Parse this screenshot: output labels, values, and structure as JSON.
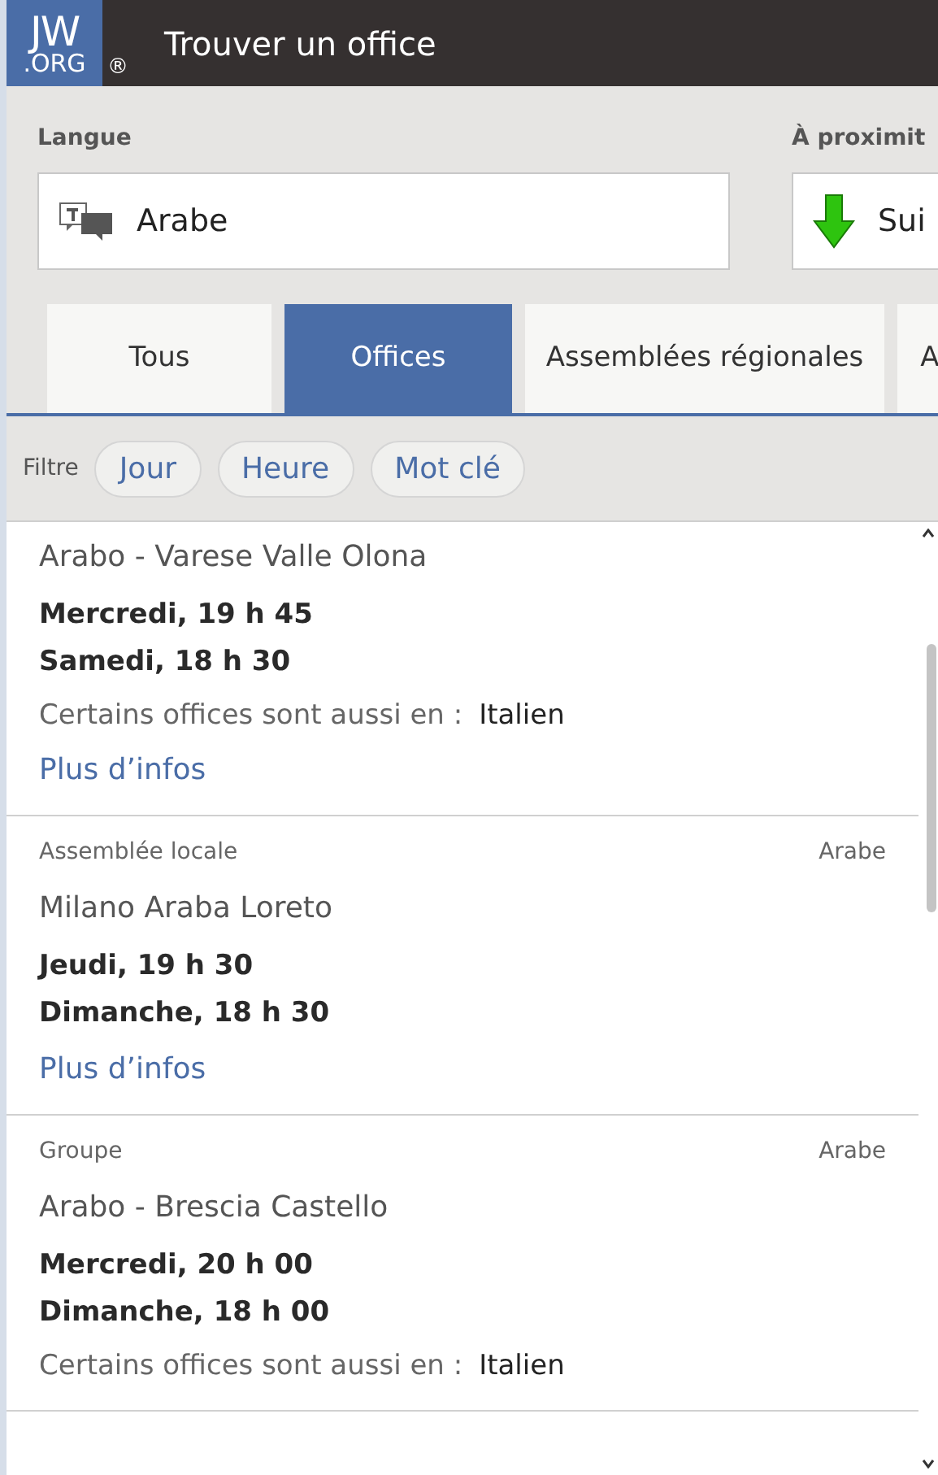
{
  "header": {
    "logo_top": "JW",
    "logo_bottom": ".ORG",
    "registered": "®",
    "title": "Trouver un office"
  },
  "fields": [
    {
      "label": "Langue",
      "value": "Arabe",
      "kind": "language"
    },
    {
      "label": "À proximit",
      "value": "Sui",
      "kind": "location"
    }
  ],
  "tabs": [
    {
      "label": "Tous",
      "selected": false
    },
    {
      "label": "Offices",
      "selected": true
    },
    {
      "label": "Assemblées régionales",
      "selected": false
    },
    {
      "label": "A",
      "selected": false
    }
  ],
  "filter": {
    "label": "Filtre",
    "chips": [
      "Jour",
      "Heure",
      "Mot clé"
    ]
  },
  "results": [
    {
      "name": "Arabo - Varese Valle Olona",
      "times": [
        "Mercredi, 19 h 45",
        "Samedi, 18 h 30"
      ],
      "also_label": "Certains offices sont aussi en :",
      "also_value": "Italien",
      "link": "Plus d’infos"
    },
    {
      "type": "Assemblée locale",
      "language": "Arabe",
      "name": "Milano Araba Loreto",
      "times": [
        "Jeudi, 19 h 30",
        "Dimanche, 18 h 30"
      ],
      "link": "Plus d’infos"
    },
    {
      "type": "Groupe",
      "language": "Arabe",
      "name": "Arabo - Brescia Castello",
      "times": [
        "Mercredi, 20 h 00",
        "Dimanche, 18 h 00"
      ],
      "also_label": "Certains offices sont aussi en :",
      "also_value": "Italien"
    }
  ]
}
